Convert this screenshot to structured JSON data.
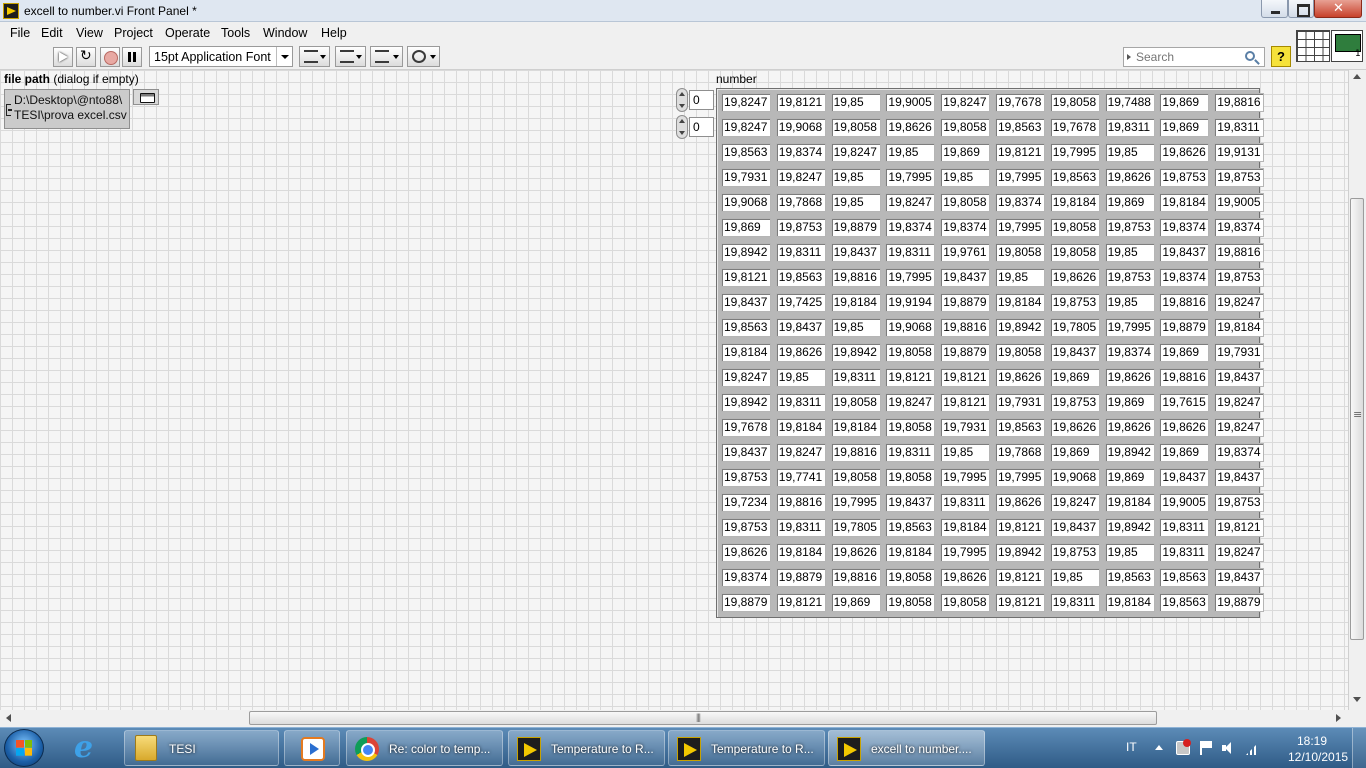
{
  "window": {
    "title": "excell to number.vi Front Panel *"
  },
  "menu": [
    "File",
    "Edit",
    "View",
    "Project",
    "Operate",
    "Tools",
    "Window",
    "Help"
  ],
  "toolbar": {
    "font_label": "15pt Application Font",
    "search_placeholder": "Search",
    "help_label": "?",
    "icons": [
      "run-arrow",
      "run-continuously",
      "abort",
      "pause",
      "align-objects",
      "distribute-objects",
      "resize-objects",
      "reorder"
    ]
  },
  "file_path_control": {
    "label": "file path",
    "label_suffix": " (dialog if empty)",
    "value": "D:\\Desktop\\@nto88\\\nTESI\\prova excel.csv"
  },
  "array_control": {
    "label": "number",
    "row_index": "0",
    "col_index": "0",
    "rows": [
      [
        "19,8247",
        "19,8121",
        "19,85",
        "19,9005",
        "19,8247",
        "19,7678",
        "19,8058",
        "19,7488",
        "19,869",
        "19,8816"
      ],
      [
        "19,8247",
        "19,9068",
        "19,8058",
        "19,8626",
        "19,8058",
        "19,8563",
        "19,7678",
        "19,8311",
        "19,869",
        "19,8311"
      ],
      [
        "19,8563",
        "19,8374",
        "19,8247",
        "19,85",
        "19,869",
        "19,8121",
        "19,7995",
        "19,85",
        "19,8626",
        "19,9131"
      ],
      [
        "19,7931",
        "19,8247",
        "19,85",
        "19,7995",
        "19,85",
        "19,7995",
        "19,8563",
        "19,8626",
        "19,8753",
        "19,8753"
      ],
      [
        "19,9068",
        "19,7868",
        "19,85",
        "19,8247",
        "19,8058",
        "19,8374",
        "19,8184",
        "19,869",
        "19,8184",
        "19,9005"
      ],
      [
        "19,869",
        "19,8753",
        "19,8879",
        "19,8374",
        "19,8374",
        "19,7995",
        "19,8058",
        "19,8753",
        "19,8374",
        "19,8374"
      ],
      [
        "19,8942",
        "19,8311",
        "19,8437",
        "19,8311",
        "19,9761",
        "19,8058",
        "19,8058",
        "19,85",
        "19,8437",
        "19,8816"
      ],
      [
        "19,8121",
        "19,8563",
        "19,8816",
        "19,7995",
        "19,8437",
        "19,85",
        "19,8626",
        "19,8753",
        "19,8374",
        "19,8753"
      ],
      [
        "19,8437",
        "19,7425",
        "19,8184",
        "19,9194",
        "19,8879",
        "19,8184",
        "19,8753",
        "19,85",
        "19,8816",
        "19,8247"
      ],
      [
        "19,8563",
        "19,8437",
        "19,85",
        "19,9068",
        "19,8816",
        "19,8942",
        "19,7805",
        "19,7995",
        "19,8879",
        "19,8184"
      ],
      [
        "19,8184",
        "19,8626",
        "19,8942",
        "19,8058",
        "19,8879",
        "19,8058",
        "19,8437",
        "19,8374",
        "19,869",
        "19,7931"
      ],
      [
        "19,8247",
        "19,85",
        "19,8311",
        "19,8121",
        "19,8121",
        "19,8626",
        "19,869",
        "19,8626",
        "19,8816",
        "19,8437"
      ],
      [
        "19,8942",
        "19,8311",
        "19,8058",
        "19,8247",
        "19,8121",
        "19,7931",
        "19,8753",
        "19,869",
        "19,7615",
        "19,8247"
      ],
      [
        "19,7678",
        "19,8184",
        "19,8184",
        "19,8058",
        "19,7931",
        "19,8563",
        "19,8626",
        "19,8626",
        "19,8626",
        "19,8247"
      ],
      [
        "19,8437",
        "19,8247",
        "19,8816",
        "19,8311",
        "19,85",
        "19,7868",
        "19,869",
        "19,8942",
        "19,869",
        "19,8374"
      ],
      [
        "19,8753",
        "19,7741",
        "19,8058",
        "19,8058",
        "19,7995",
        "19,7995",
        "19,9068",
        "19,869",
        "19,8437",
        "19,8437"
      ],
      [
        "19,7234",
        "19,8816",
        "19,7995",
        "19,8437",
        "19,8311",
        "19,8626",
        "19,8247",
        "19,8184",
        "19,9005",
        "19,8753"
      ],
      [
        "19,8753",
        "19,8311",
        "19,7805",
        "19,8563",
        "19,8184",
        "19,8121",
        "19,8437",
        "19,8942",
        "19,8311",
        "19,8121"
      ],
      [
        "19,8626",
        "19,8184",
        "19,8626",
        "19,8184",
        "19,7995",
        "19,8942",
        "19,8753",
        "19,85",
        "19,8311",
        "19,8247"
      ],
      [
        "19,8374",
        "19,8879",
        "19,8816",
        "19,8058",
        "19,8626",
        "19,8121",
        "19,85",
        "19,8563",
        "19,8563",
        "19,8437"
      ],
      [
        "19,8879",
        "19,8121",
        "19,869",
        "19,8058",
        "19,8058",
        "19,8121",
        "19,8311",
        "19,8184",
        "19,8563",
        "19,8879"
      ]
    ]
  },
  "taskbar": {
    "tasks": [
      {
        "label": "TESI",
        "icon": "folder-icon"
      },
      {
        "label": "",
        "icon": "media-player-icon"
      },
      {
        "label": "Re: color to temp...",
        "icon": "chrome-icon"
      },
      {
        "label": "Temperature to R...",
        "icon": "labview-icon"
      },
      {
        "label": "Temperature to R...",
        "icon": "labview-icon"
      },
      {
        "label": "excell to number....",
        "icon": "labview-icon"
      }
    ],
    "language": "IT",
    "time": "18:19",
    "date": "12/10/2015"
  }
}
